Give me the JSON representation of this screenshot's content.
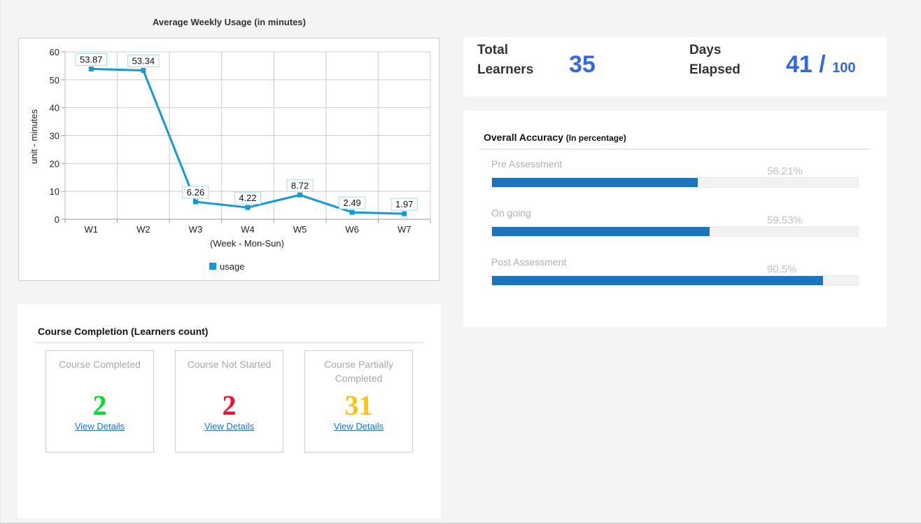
{
  "usage_chart": {
    "title": "Average Weekly Usage (in minutes)"
  },
  "chart_data": {
    "type": "line",
    "title": "Average Weekly Usage (in minutes)",
    "xlabel": "(Week - Mon-Sun)",
    "ylabel": "unit - minutes",
    "categories": [
      "W1",
      "W2",
      "W3",
      "W4",
      "W5",
      "W6",
      "W7"
    ],
    "series": [
      {
        "name": "usage",
        "values": [
          53.87,
          53.34,
          6.26,
          4.22,
          8.72,
          2.49,
          1.97
        ],
        "color": "#0e9bdc"
      }
    ],
    "data_labels": [
      "53.87",
      "53.34",
      "6.26",
      "4.22",
      "8.72",
      "2.49",
      "1.97"
    ],
    "yticks": [
      0,
      10,
      20,
      30,
      40,
      50,
      60
    ],
    "ylim": [
      0,
      60
    ],
    "grid": true,
    "legend": {
      "position": "bottom",
      "entries": [
        "usage"
      ]
    }
  },
  "stats": {
    "total_learners": {
      "label_line1": "Total",
      "label_line2": "Learners",
      "value": "35"
    },
    "days_elapsed": {
      "label_line1": "Days",
      "label_line2": "Elapsed",
      "value": "41",
      "separator": "/",
      "total": "100"
    }
  },
  "accuracy": {
    "title": "Overall Accuracy",
    "subtitle": "(In percentage)",
    "items": [
      {
        "label": "Pre Assessment",
        "value_text": "56.21%",
        "percent": 56.21
      },
      {
        "label": "On going",
        "value_text": "59.53%",
        "percent": 59.53
      },
      {
        "label": "Post Assessment",
        "value_text": "90.5%",
        "percent": 90.5
      }
    ],
    "bar_color": "#1c75bc"
  },
  "completion": {
    "title": "Course Completion (Learners count)",
    "cards": [
      {
        "label": "Course Completed",
        "count": "2",
        "color": "#00e020",
        "link": "View Details"
      },
      {
        "label": "Course Not Started",
        "count": "2",
        "color": "#ff0a2a",
        "link": "View Details"
      },
      {
        "label": "Course Partially Completed",
        "count": "31",
        "color": "#ffc20e",
        "link": "View Details"
      }
    ]
  }
}
